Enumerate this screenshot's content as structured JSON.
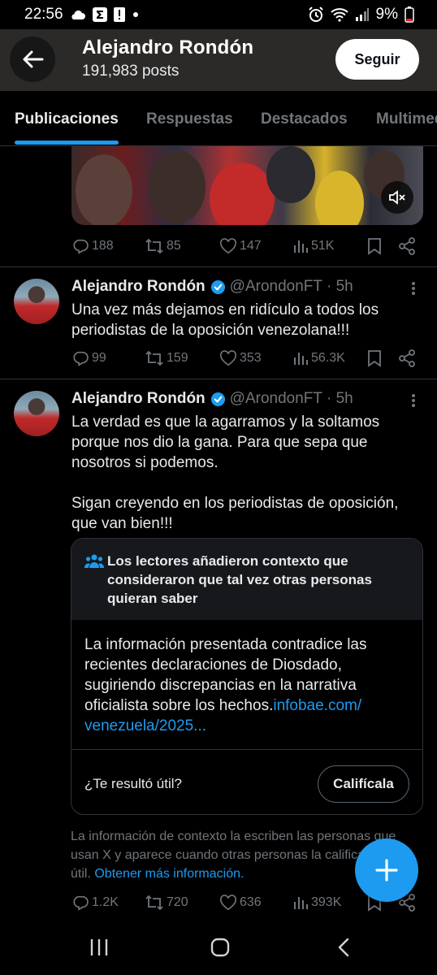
{
  "status_bar": {
    "time": "22:56",
    "battery": "9%"
  },
  "header": {
    "name": "Alejandro Rondón",
    "posts": "191,983 posts",
    "follow_label": "Seguir"
  },
  "tabs": [
    {
      "label": "Publicaciones",
      "active": true
    },
    {
      "label": "Respuestas",
      "active": false
    },
    {
      "label": "Destacados",
      "active": false
    },
    {
      "label": "Multimedia",
      "active": false
    }
  ],
  "post0": {
    "replies": "188",
    "reposts": "85",
    "likes": "147",
    "views": "51K"
  },
  "post1": {
    "name": "Alejandro Rondón",
    "handle": "@ArondonFT",
    "time": "· 5h",
    "text": "Una vez más dejamos en ridículo a todos los periodistas de la oposición venezolana!!!",
    "replies": "99",
    "reposts": "159",
    "likes": "353",
    "views": "56.3K"
  },
  "post2": {
    "name": "Alejandro Rondón",
    "handle": "@ArondonFT",
    "time": "· 5h",
    "text": "La verdad es que la agarramos y la soltamos porque nos dio la gana. Para que sepa que nosotros si podemos.\n\nSigan creyendo en los periodistas de oposición, que van bien!!!",
    "replies": "1.2K",
    "reposts": "720",
    "likes": "636",
    "views": "393K"
  },
  "community_note": {
    "title": "Los lectores añadieron contexto que consideraron que tal vez otras personas quieran saber",
    "body": "La información presentada contradice las recientes declaraciones de Diosdado, sugiriendo discrepancias en la narrativa oficialista sobre los hechos.",
    "link": "infobae.com/ venezuela/2025...",
    "question": "¿Te resultó útil?",
    "rate_label": "Califícala",
    "footer": "La información de contexto la escriben las personas que usan X y aparece cuando otras personas la califican como útil.",
    "footer_link": "Obtener más información."
  },
  "colors": {
    "accent": "#1d9bf0",
    "background": "#000000",
    "muted": "#71767b",
    "text": "#e7e9ea",
    "header_bg": "#2c2a28"
  }
}
